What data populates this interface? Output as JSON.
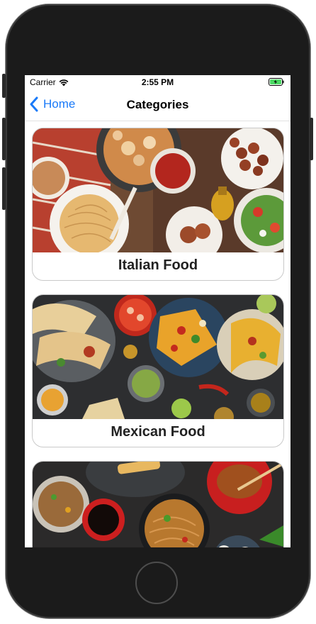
{
  "status_bar": {
    "carrier": "Carrier",
    "time": "2:55 PM"
  },
  "nav": {
    "back_label": "Home",
    "title": "Categories"
  },
  "categories": [
    {
      "label": "Italian Food"
    },
    {
      "label": "Mexican Food"
    },
    {
      "label": ""
    }
  ],
  "colors": {
    "accent": "#1a7af8",
    "battery": "#4cd964"
  }
}
